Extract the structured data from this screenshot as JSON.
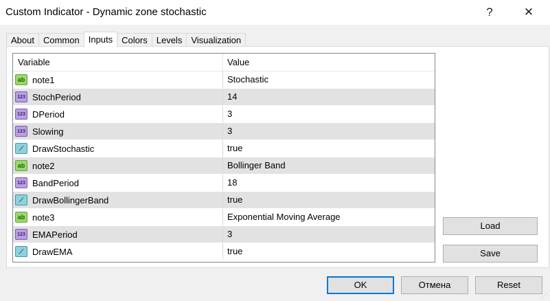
{
  "window": {
    "title": "Custom Indicator - Dynamic zone stochastic",
    "help_glyph": "?",
    "close_glyph": "✕"
  },
  "tabs": [
    {
      "label": "About",
      "active": false
    },
    {
      "label": "Common",
      "active": false
    },
    {
      "label": "Inputs",
      "active": true
    },
    {
      "label": "Colors",
      "active": false
    },
    {
      "label": "Levels",
      "active": false
    },
    {
      "label": "Visualization",
      "active": false
    }
  ],
  "grid": {
    "columns": [
      "Variable",
      "Value"
    ],
    "rows": [
      {
        "icon": "string-icon",
        "icon_text": "ab",
        "name": "note1",
        "value": "Stochastic"
      },
      {
        "icon": "integer-icon",
        "icon_text": "123",
        "name": "StochPeriod",
        "value": "14"
      },
      {
        "icon": "integer-icon",
        "icon_text": "123",
        "name": "DPeriod",
        "value": "3"
      },
      {
        "icon": "integer-icon",
        "icon_text": "123",
        "name": "Slowing",
        "value": "3"
      },
      {
        "icon": "boolean-icon",
        "icon_text": "⟋",
        "name": "DrawStochastic",
        "value": "true"
      },
      {
        "icon": "string-icon",
        "icon_text": "ab",
        "name": "note2",
        "value": "Bollinger Band"
      },
      {
        "icon": "integer-icon",
        "icon_text": "123",
        "name": "BandPeriod",
        "value": "18"
      },
      {
        "icon": "boolean-icon",
        "icon_text": "⟋",
        "name": "DrawBollingerBand",
        "value": "true"
      },
      {
        "icon": "string-icon",
        "icon_text": "ab",
        "name": "note3",
        "value": "Exponential Moving Average"
      },
      {
        "icon": "integer-icon",
        "icon_text": "123",
        "name": "EMAPeriod",
        "value": "3"
      },
      {
        "icon": "boolean-icon",
        "icon_text": "⟋",
        "name": "DrawEMA",
        "value": "true"
      }
    ]
  },
  "side_buttons": {
    "load": "Load",
    "save": "Save"
  },
  "footer_buttons": {
    "ok": "OK",
    "cancel": "Отмена",
    "reset": "Reset"
  },
  "colors": {
    "accent": "#0078d7",
    "alt_row": "#e2e2e2"
  }
}
